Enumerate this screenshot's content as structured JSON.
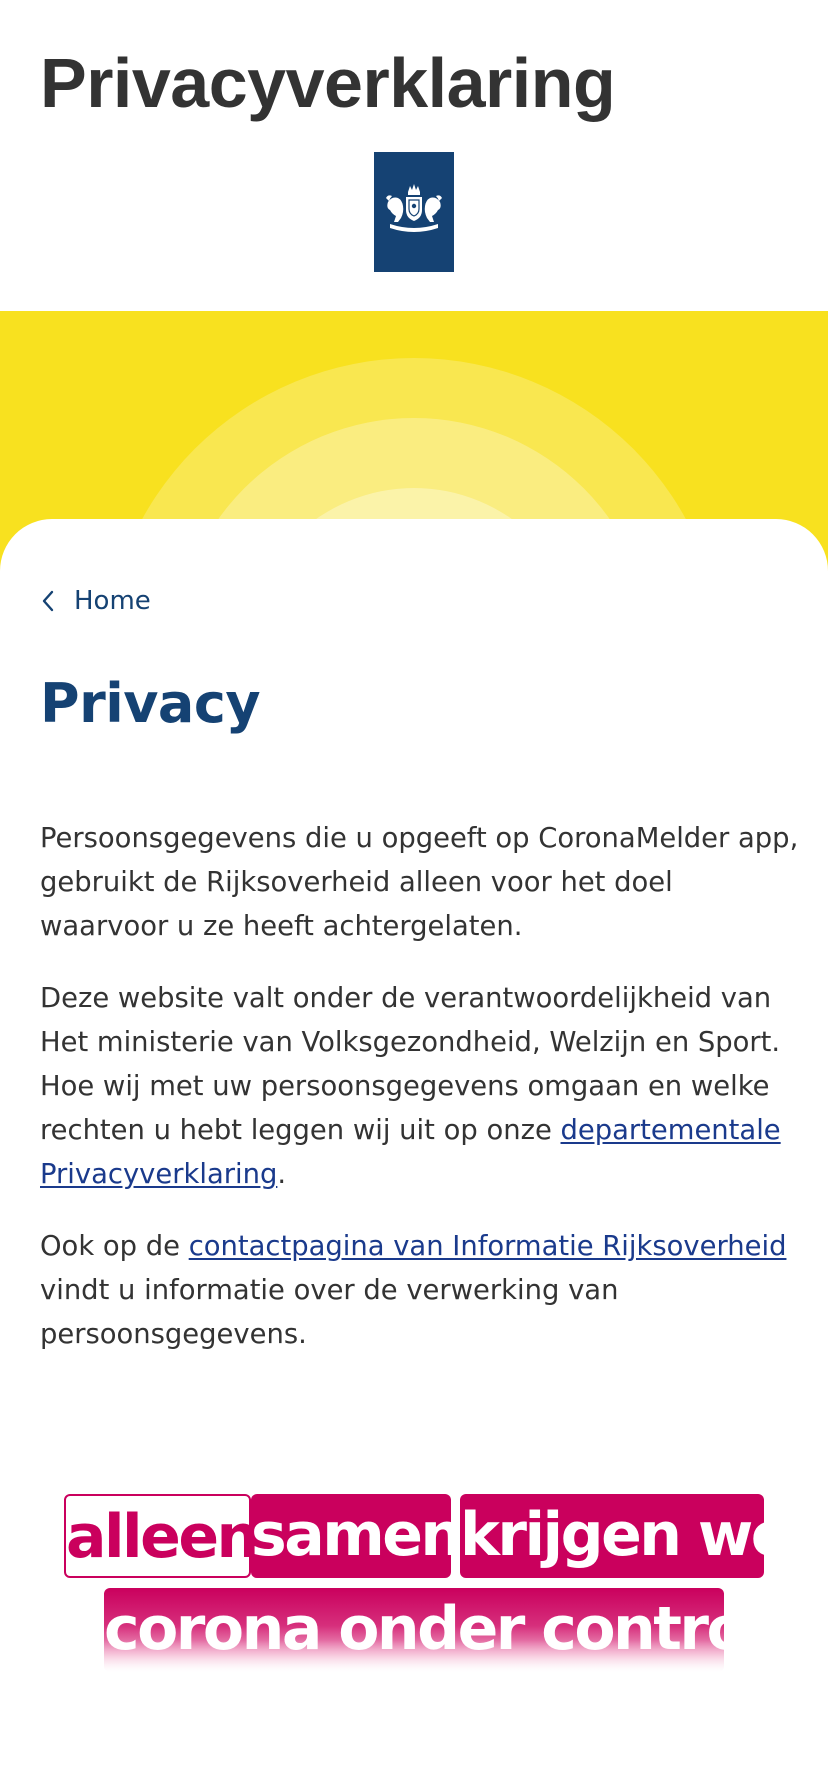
{
  "header": {
    "title": "Privacyverklaring",
    "logo_icon": "rijksoverheid-coat-of-arms-icon",
    "logo_color": "#154273"
  },
  "hero": {
    "background_color": "#f8e11f"
  },
  "breadcrumb": {
    "icon": "chevron-left-icon",
    "label": "Home"
  },
  "main": {
    "title": "Privacy",
    "paragraphs": {
      "p1": "Persoonsgegevens die u opgeeft op CoronaMelder app, gebruikt de Rijksoverheid alleen voor het doel waarvoor u ze heeft achtergelaten.",
      "p2_before": "Deze website valt onder de verantwoordelijkheid van Het ministerie van Volksgezondheid, Welzijn en Sport. Hoe wij met uw persoonsgegevens omgaan en welke rechten u hebt leggen wij uit op onze ",
      "p2_link": "departementale Privacyverklaring",
      "p2_after": ".",
      "p3_before": "Ook op de ",
      "p3_link": "contactpagina van Informatie Rijksoverheid",
      "p3_after": " vindt u informatie over de verwerking van persoonsgegevens."
    },
    "title_color": "#154273",
    "link_color": "#1a3a8c"
  },
  "slogan": {
    "word1": "alleen",
    "word2": "samen",
    "word3": "krijgen we",
    "line2": "corona onder controle",
    "accent_color": "#ca005d"
  }
}
